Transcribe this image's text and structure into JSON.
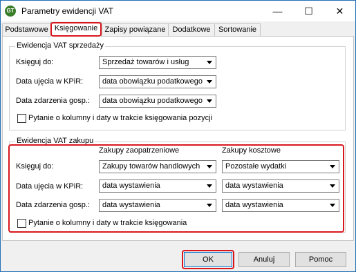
{
  "window": {
    "title": "Parametry ewidencji VAT",
    "icon_text": "GT"
  },
  "titlebar": {
    "minimize": "—",
    "maximize": "☐",
    "close": "✕"
  },
  "tabs": [
    "Podstawowe",
    "Księgowanie",
    "Zapisy powiązane",
    "Dodatkowe",
    "Sortowanie"
  ],
  "active_tab": "Księgowanie",
  "sales": {
    "title": "Ewidencja VAT sprzedaży",
    "book_label": "Księguj do:",
    "book_value": "Sprzedaż towarów i usług",
    "entry_label": "Data ujęcia w KPiR:",
    "entry_value": "data obowiązku podatkowego",
    "event_label": "Data zdarzenia gosp.:",
    "event_value": "data obowiązku podatkowego",
    "ask_label": "Pytanie o kolumny i daty w trakcie księgowania pozycji"
  },
  "purchase": {
    "title": "Ewidencja VAT zakupu",
    "col_supply": "Zakupy zaopatrzeniowe",
    "col_cost": "Zakupy kosztowe",
    "book_label": "Księguj do:",
    "book_supply": "Zakupy towarów handlowych",
    "book_cost": "Pozostałe wydatki",
    "entry_label": "Data ujęcia w KPiR:",
    "entry_supply": "data wystawienia",
    "entry_cost": "data wystawienia",
    "event_label": "Data zdarzenia gosp.:",
    "event_supply": "data wystawienia",
    "event_cost": "data wystawienia",
    "ask_label": "Pytanie o kolumny i daty w trakcie księgowania"
  },
  "buttons": {
    "ok": "OK",
    "cancel": "Anuluj",
    "help": "Pomoc"
  },
  "colors": {
    "highlight": "#d9161c",
    "title_border": "#1f6fb5"
  }
}
